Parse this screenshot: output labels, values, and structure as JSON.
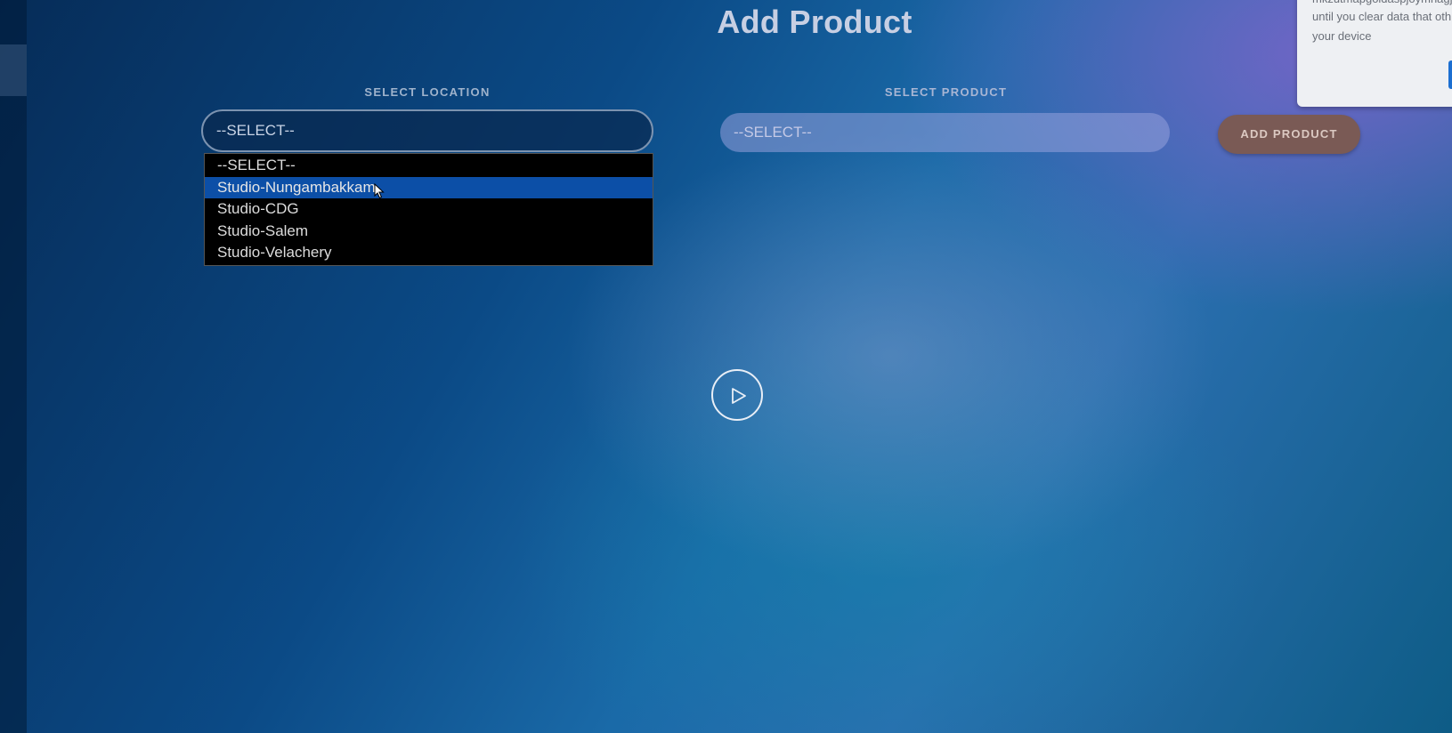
{
  "page": {
    "title": "Add Product"
  },
  "location_field": {
    "label": "SELECT LOCATION",
    "selected_value": "--SELECT--",
    "options": [
      "--SELECT--",
      "Studio-Nungambakkam",
      "Studio-CDG",
      "Studio-Salem",
      "Studio-Velachery"
    ],
    "highlighted_option": "Studio-Nungambakkam"
  },
  "product_field": {
    "label": "SELECT PRODUCT",
    "selected_value": "--SELECT--"
  },
  "actions": {
    "add_product_label": "ADD PRODUCT"
  },
  "media": {
    "play_icon": "play-icon"
  },
  "notice": {
    "lines": [
      "mkzutmapgoldaspjoymnagj",
      "until you clear data that oth",
      "your device"
    ]
  },
  "colors": {
    "dropdown_highlight": "#0c4fa7",
    "add_button": "#7a5a55",
    "dropdown_background": "#000000"
  }
}
